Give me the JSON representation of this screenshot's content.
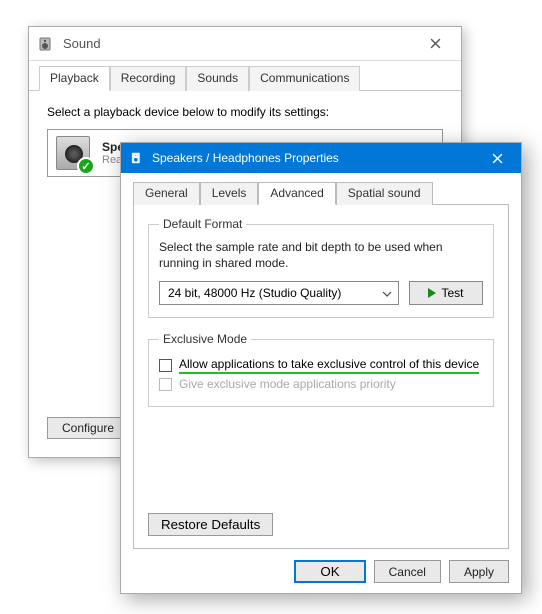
{
  "sound": {
    "title": "Sound",
    "tabs": [
      "Playback",
      "Recording",
      "Sounds",
      "Communications"
    ],
    "instruction": "Select a playback device below to modify its settings:",
    "device": {
      "name": "Speakers / Headphones",
      "sub": "Realtek High Definition Audio"
    },
    "configure": "Configure"
  },
  "props": {
    "title": "Speakers / Headphones Properties",
    "tabs": [
      "General",
      "Levels",
      "Advanced",
      "Spatial sound"
    ],
    "default_format": {
      "legend": "Default Format",
      "hint": "Select the sample rate and bit depth to be used when running in shared mode.",
      "value": "24 bit, 48000 Hz (Studio Quality)",
      "test": "Test"
    },
    "exclusive": {
      "legend": "Exclusive Mode",
      "opt1": "Allow applications to take exclusive control of this device",
      "opt2": "Give exclusive mode applications priority"
    },
    "restore": "Restore Defaults",
    "ok": "OK",
    "cancel": "Cancel",
    "apply": "Apply"
  }
}
